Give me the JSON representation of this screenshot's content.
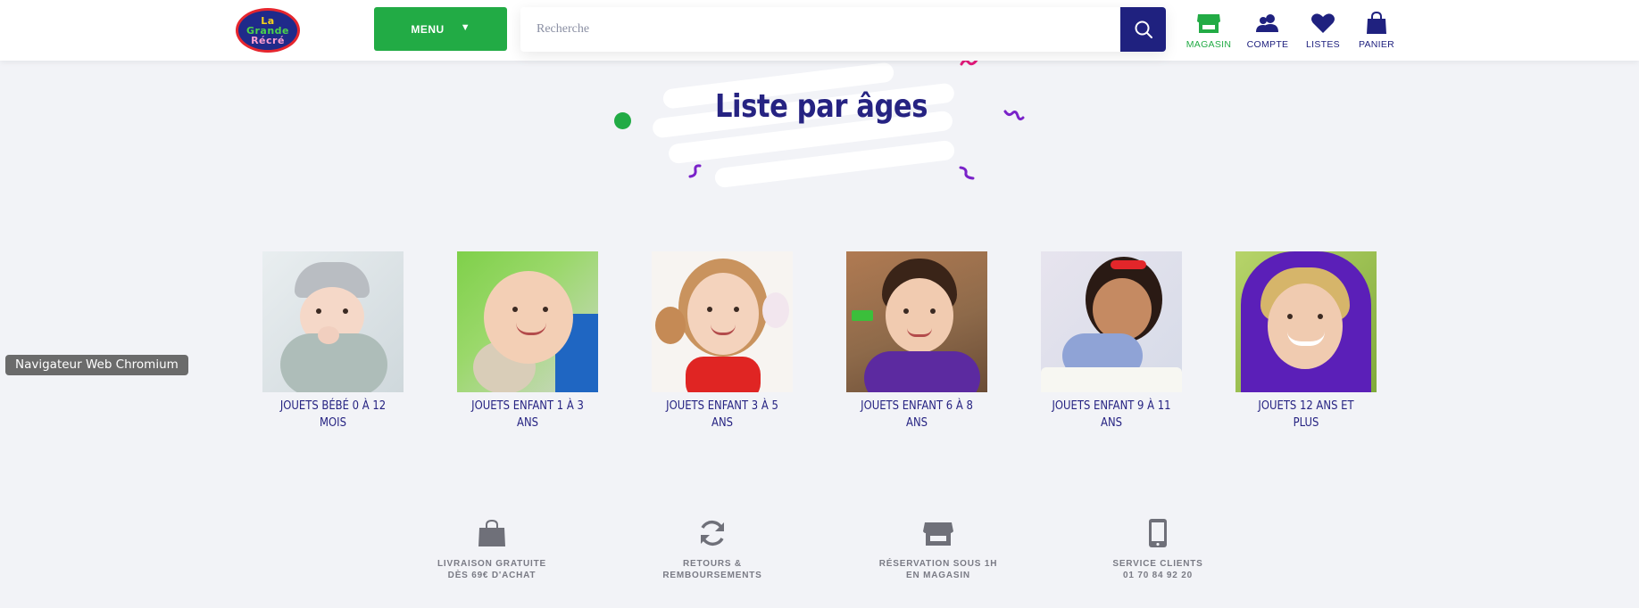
{
  "header": {
    "logo_text": [
      "La",
      "Grande",
      "Récré"
    ],
    "menu_label": "MENU",
    "search_placeholder": "Recherche",
    "nav": [
      {
        "label": "MAGASIN",
        "icon": "store-icon",
        "active": true
      },
      {
        "label": "COMPTE",
        "icon": "users-icon",
        "active": false
      },
      {
        "label": "LISTES",
        "icon": "heart-icon",
        "active": false
      },
      {
        "label": "PANIER",
        "icon": "shopping-bag-icon",
        "active": false
      }
    ]
  },
  "main": {
    "title": "Liste par âges",
    "categories": [
      {
        "label": "JOUETS BÉBÉ 0 À 12 MOIS"
      },
      {
        "label": "JOUETS ENFANT 1 À 3 ANS"
      },
      {
        "label": "JOUETS ENFANT 3 À 5 ANS"
      },
      {
        "label": "JOUETS ENFANT 6 À 8 ANS"
      },
      {
        "label": "JOUETS ENFANT 9 À 11 ANS"
      },
      {
        "label": "JOUETS 12 ANS ET PLUS"
      }
    ]
  },
  "tooltip": "Navigateur Web Chromium",
  "features": [
    {
      "line1": "LIVRAISON GRATUITE",
      "line2": "DÈS 69€ D'ACHAT",
      "icon": "bag-icon"
    },
    {
      "line1": "RETOURS &",
      "line2": "REMBOURSEMENTS",
      "icon": "refresh-icon"
    },
    {
      "line1": "RÉSERVATION SOUS 1H",
      "line2": "EN MAGASIN",
      "icon": "store-icon"
    },
    {
      "line1": "SERVICE CLIENTS",
      "line2": "01 70 84 92 20",
      "icon": "phone-icon"
    }
  ],
  "colors": {
    "brand_navy": "#262382",
    "brand_green": "#22ab45",
    "accent_pink": "#e5197c",
    "accent_purple": "#7a22c9",
    "background": "#f2f3f7"
  }
}
